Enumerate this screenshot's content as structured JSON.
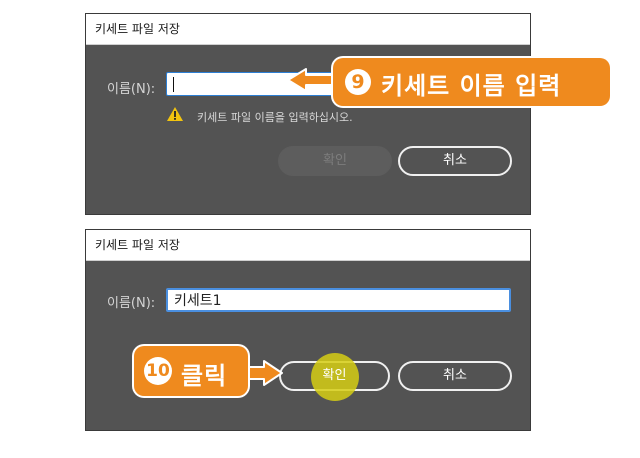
{
  "dialog1": {
    "title": "키세트 파일 저장",
    "name_label": "이름(N):",
    "name_value": "",
    "warning": "키세트 파일 이름을 입력하십시오.",
    "ok_label": "확인",
    "cancel_label": "취소"
  },
  "dialog2": {
    "title": "키세트 파일 저장",
    "name_label": "이름(N):",
    "name_value": "키세트1",
    "ok_label": "확인",
    "cancel_label": "취소"
  },
  "callouts": {
    "step9_number": "9",
    "step9_text": "키세트 이름 입력",
    "step10_number": "10",
    "step10_text": "클릭"
  },
  "colors": {
    "dialog_bg": "#535353",
    "callout_orange": "#ef8a1e",
    "click_highlight": "#d6ce14",
    "input_focus_border": "#4a8fe0"
  },
  "icons": [
    "warning-icon",
    "text-caret"
  ]
}
